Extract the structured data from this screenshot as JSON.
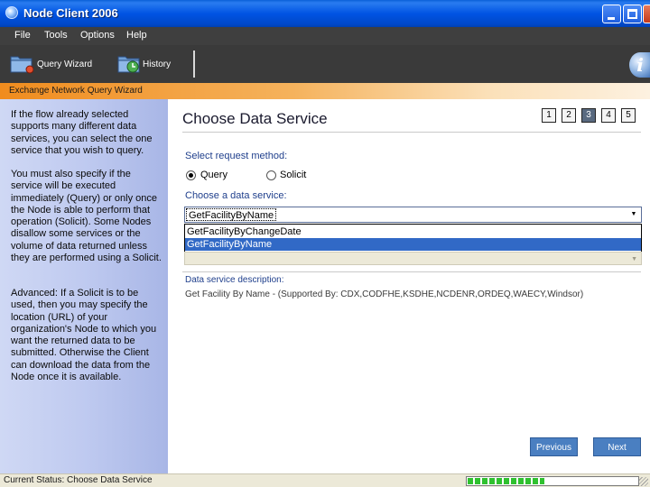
{
  "window": {
    "title": "Node Client 2006",
    "controls": {
      "minimize": "_",
      "maximize": "□",
      "close": "✕"
    }
  },
  "menu": {
    "items": [
      {
        "label": "File"
      },
      {
        "label": "Tools"
      },
      {
        "label": "Options"
      },
      {
        "label": "Help"
      }
    ]
  },
  "toolbar": {
    "query_wizard_label": "Query Wizard",
    "history_label": "History",
    "info_glyph": "i"
  },
  "wizard": {
    "header": "Exchange Network Query Wizard",
    "title": "Choose Data Service",
    "steps": [
      "1",
      "2",
      "3",
      "4",
      "5"
    ],
    "active_step": "3"
  },
  "help": {
    "paragraphs": [
      "If the flow already selected supports many different data services, you can select the one service that you wish to query.",
      "You must also specify if the service will be executed immediately (Query) or only once the Node is able to perform that operation (Solicit). Some Nodes disallow some services or the volume of data returned unless they are performed using a Solicit.",
      "Advanced: If a Solicit is to be used, then you may specify the location (URL) of your organization's Node to which you want the returned data to be submitted. Otherwise the Client can download the data from the Node once it is available."
    ]
  },
  "form": {
    "request_method_label": "Select request method:",
    "request_method_options": [
      {
        "label": "Query",
        "selected": true
      },
      {
        "label": "Solicit",
        "selected": false
      }
    ],
    "data_service_label": "Choose a data service:",
    "data_service_value": "GetFacilityByName",
    "data_service_options": [
      {
        "label": "GetFacilityByChangeDate",
        "selected": false
      },
      {
        "label": "GetFacilityByName",
        "selected": true
      }
    ],
    "description_label": "Data service description:",
    "description_text": "Get Facility By Name - (Supported By: CDX,CODFHE,KSDHE,NCDENR,ORDEQ,WAECY,Windsor)"
  },
  "buttons": {
    "previous": "Previous",
    "next": "Next"
  },
  "status": {
    "text": "Current Status:  Choose Data Service",
    "progress": 0.45
  },
  "colors": {
    "accent_orange": "#f08c1e",
    "label_blue": "#1f3f8c",
    "button_blue": "#4a7fc1",
    "selection_blue": "#3169c6",
    "progress_green": "#2fc12f"
  }
}
